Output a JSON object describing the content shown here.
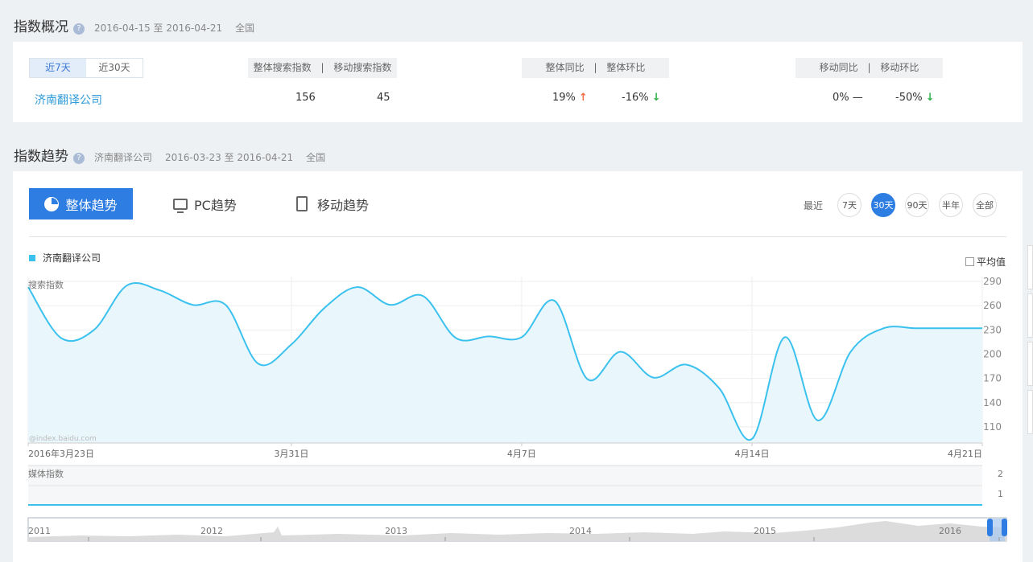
{
  "overview": {
    "title": "指数概况",
    "help_icon": "question-icon",
    "date_range": "2016-04-15 至 2016-04-21",
    "region": "全国",
    "toggle": [
      "近7天",
      "近30天"
    ],
    "keyword": "济南翻译公司",
    "search_header": [
      "整体搜索指数",
      "|",
      "移动搜索指数"
    ],
    "yoy_header": [
      "整体同比",
      "|",
      "整体环比"
    ],
    "mob_header": [
      "移动同比",
      "|",
      "移动环比"
    ],
    "search_values": [
      "156",
      "45"
    ],
    "yoy_values": [
      "19%",
      "-16%"
    ],
    "mob_values": [
      "0%",
      "-50%"
    ],
    "arrows": {
      "up": "↑",
      "down": "↓",
      "flat": "—"
    }
  },
  "trend": {
    "title": "指数趋势",
    "keyword": "济南翻译公司",
    "date_range": "2016-03-23 至 2016-04-21",
    "region": "全国",
    "tabs": [
      "整体趋势",
      "PC趋势",
      "移动趋势"
    ],
    "range_label": "最近",
    "ranges": [
      "7天",
      "30天",
      "90天",
      "半年",
      "全部"
    ],
    "active_range": "30天",
    "avg_label": "平均值",
    "watermark": "@index.baidu.com",
    "media_label": "媒体指数",
    "media_ticks": [
      "2",
      "1"
    ],
    "timeline_years": [
      "2011",
      "2012",
      "2013",
      "2014",
      "2015",
      "2016"
    ]
  },
  "chart_data": {
    "type": "area",
    "ylabel": "搜索指数",
    "y_ticks": [
      290,
      260,
      230,
      200,
      170,
      140,
      110
    ],
    "ylim": [
      90,
      296
    ],
    "x_tick_labels": [
      "2016年3月23日",
      "3月31日",
      "4月7日",
      "4月14日",
      "4月21日"
    ],
    "x_tick_index": [
      0,
      8,
      15,
      22,
      29
    ],
    "color": "#3ac1ee",
    "series": [
      {
        "name": "济南翻译公司",
        "x": [
          "2016-03-23",
          "2016-03-24",
          "2016-03-25",
          "2016-03-26",
          "2016-03-27",
          "2016-03-28",
          "2016-03-29",
          "2016-03-30",
          "2016-03-31",
          "2016-04-01",
          "2016-04-02",
          "2016-04-03",
          "2016-04-04",
          "2016-04-05",
          "2016-04-06",
          "2016-04-07",
          "2016-04-08",
          "2016-04-09",
          "2016-04-10",
          "2016-04-11",
          "2016-04-12",
          "2016-04-13",
          "2016-04-14",
          "2016-04-15",
          "2016-04-16",
          "2016-04-17",
          "2016-04-18",
          "2016-04-19",
          "2016-04-20",
          "2016-04-21"
        ],
        "values": [
          283,
          220,
          230,
          285,
          279,
          261,
          261,
          188,
          212,
          257,
          283,
          261,
          272,
          220,
          222,
          221,
          266,
          169,
          203,
          171,
          187,
          158,
          95,
          221,
          118,
          203,
          232,
          232,
          232,
          232
        ]
      }
    ]
  }
}
